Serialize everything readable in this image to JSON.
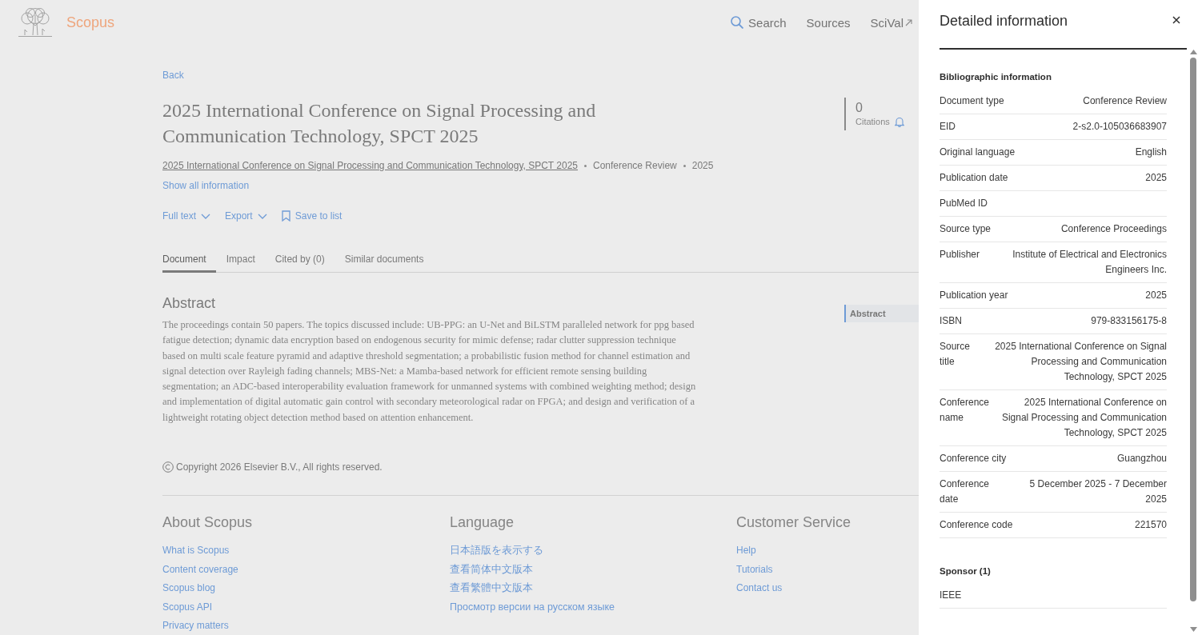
{
  "header": {
    "logo": "Scopus",
    "nav": [
      {
        "label": "Search",
        "kind": "search"
      },
      {
        "label": "Sources",
        "kind": "plain"
      },
      {
        "label": "SciVal",
        "kind": "external"
      }
    ]
  },
  "document": {
    "back": "Back",
    "title": "2025 International Conference on Signal Processing and Communication Technology, SPCT 2025",
    "source": "2025 International Conference on Signal Processing and Communication Technology, SPCT 2025",
    "meta": [
      "Conference Review",
      "2025"
    ],
    "show_all": "Show all information",
    "actions": [
      {
        "label": "Full text",
        "kind": "dropdown"
      },
      {
        "label": "Export",
        "kind": "dropdown"
      },
      {
        "label": "Save to list",
        "kind": "bookmark"
      }
    ],
    "citations": {
      "count": "0",
      "label": "Citations"
    }
  },
  "tabs": [
    {
      "label": "Document",
      "selected": true
    },
    {
      "label": "Impact",
      "selected": false
    },
    {
      "label": "Cited by (0)",
      "selected": false
    },
    {
      "label": "Similar documents",
      "selected": false
    }
  ],
  "abstract": {
    "heading": "Abstract",
    "text": "The proceedings contain 50 papers. The topics discussed include: UB-PPG: an U-Net and BiLSTM paralleled network for ppg based fatigue detection; dynamic data encryption based on endogenous security for mimic defense; radar clutter suppression technique based on multi scale feature pyramid and adaptive threshold segmentation; a probabilistic fusion method for channel estimation and signal detection over Rayleigh fading channels; MBS-Net: a Mamba-based network for efficient remote sensing building segmentation; an ADC-based interoperability evaluation framework for unmanned systems with combined weighting method; design and implementation of digital automatic gain control with secondary meteorological radar on FPGA; and design and verification of a lightweight rotating object detection method based on attention enhancement."
  },
  "outline": [
    {
      "label": "Abstract",
      "selected": true
    }
  ],
  "copyright": "Copyright 2026 Elsevier B.V., All rights reserved.",
  "footer": [
    {
      "heading": "About Scopus",
      "links": [
        "What is Scopus",
        "Content coverage",
        "Scopus blog",
        "Scopus API",
        "Privacy matters"
      ]
    },
    {
      "heading": "Language",
      "links": [
        "日本語版を表示する",
        "查看简体中文版本",
        "查看繁體中文版本",
        "Просмотр версии на русском языке"
      ]
    },
    {
      "heading": "Customer Service",
      "links": [
        "Help",
        "Tutorials",
        "Contact us"
      ]
    }
  ],
  "panel": {
    "title": "Detailed information",
    "sections": [
      {
        "heading": "Bibliographic information",
        "rows": [
          {
            "label": "Document type",
            "value": "Conference Review"
          },
          {
            "label": "EID",
            "value": "2-s2.0-105036683907"
          },
          {
            "label": "Original language",
            "value": "English"
          },
          {
            "label": "Publication date",
            "value": "2025"
          },
          {
            "label": "PubMed ID"
          },
          {
            "label": "Source type",
            "value": "Conference Proceedings"
          },
          {
            "label": "Publisher",
            "value": "Institute of Electrical and Electronics Engineers Inc."
          },
          {
            "label": "Publication year",
            "value": "2025"
          },
          {
            "label": "ISBN",
            "value": "979-833156175-8"
          },
          {
            "label": "Source title",
            "value": "2025 International Conference on Signal Processing and Communication Technology, SPCT 2025"
          },
          {
            "label": "Conference name",
            "value": "2025 International Conference on Signal Processing and Communication Technology, SPCT 2025"
          },
          {
            "label": "Conference city",
            "value": "Guangzhou"
          },
          {
            "label": "Conference date",
            "value": "5 December 2025 - 7 December 2025"
          },
          {
            "label": "Conference code",
            "value": "221570"
          }
        ]
      },
      {
        "heading": "Sponsor (1)",
        "rows": [
          {
            "label": "IEEE"
          }
        ]
      }
    ]
  }
}
